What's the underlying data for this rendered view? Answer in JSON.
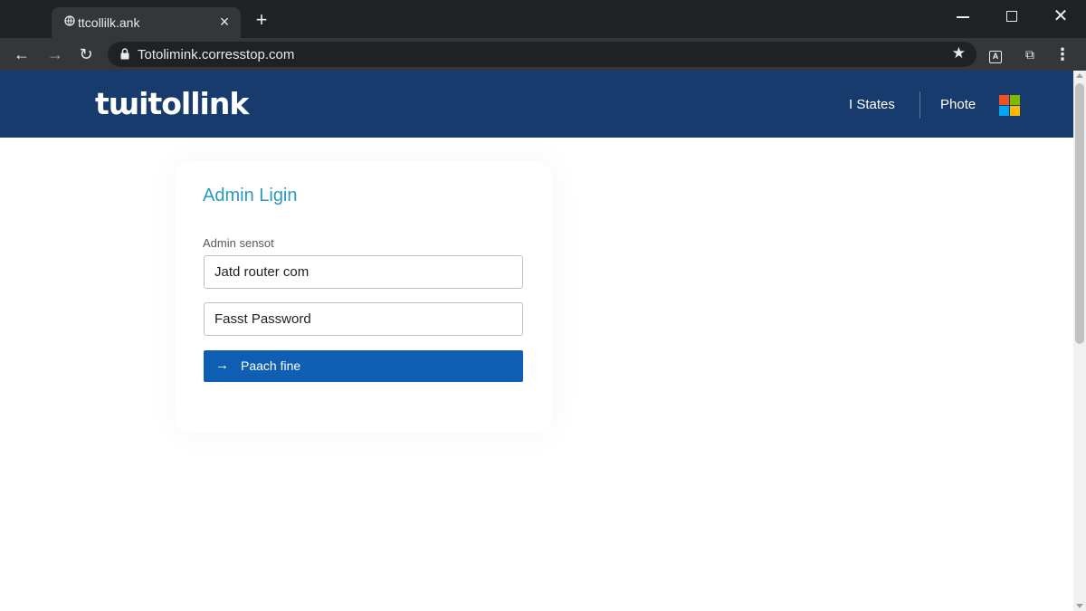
{
  "browser": {
    "tab": {
      "favicon": "globe-icon",
      "title": "ttcollilk.ank",
      "close_glyph": "×"
    },
    "new_tab_glyph": "+",
    "window_controls": {
      "close_glyph": "✕"
    },
    "nav": {
      "back_glyph": "←",
      "forward_glyph": "→",
      "reload_glyph": "↻"
    },
    "address_bar": {
      "url": "Totolimink.corresstop.com",
      "bookmark_glyph": "★"
    },
    "toolbar": {
      "extension_glyph": "A",
      "puzzle_glyph": "⧉",
      "menu_glyph": "⋮"
    }
  },
  "site": {
    "logo_text": "tɯitollink",
    "nav": {
      "states": "I States",
      "photo": "Phote"
    },
    "brand_colors": {
      "header": "#173b6c",
      "accent": "#2a9ac0",
      "button": "#0e5fb3"
    }
  },
  "login": {
    "title": "Admin Ligin",
    "field_label": "Admin sensot",
    "username_value": "Jatd router com",
    "password_value": "Fasst Password",
    "submit_label": "Paach fine",
    "submit_icon": "arrow-right-icon",
    "submit_glyph": "→"
  }
}
